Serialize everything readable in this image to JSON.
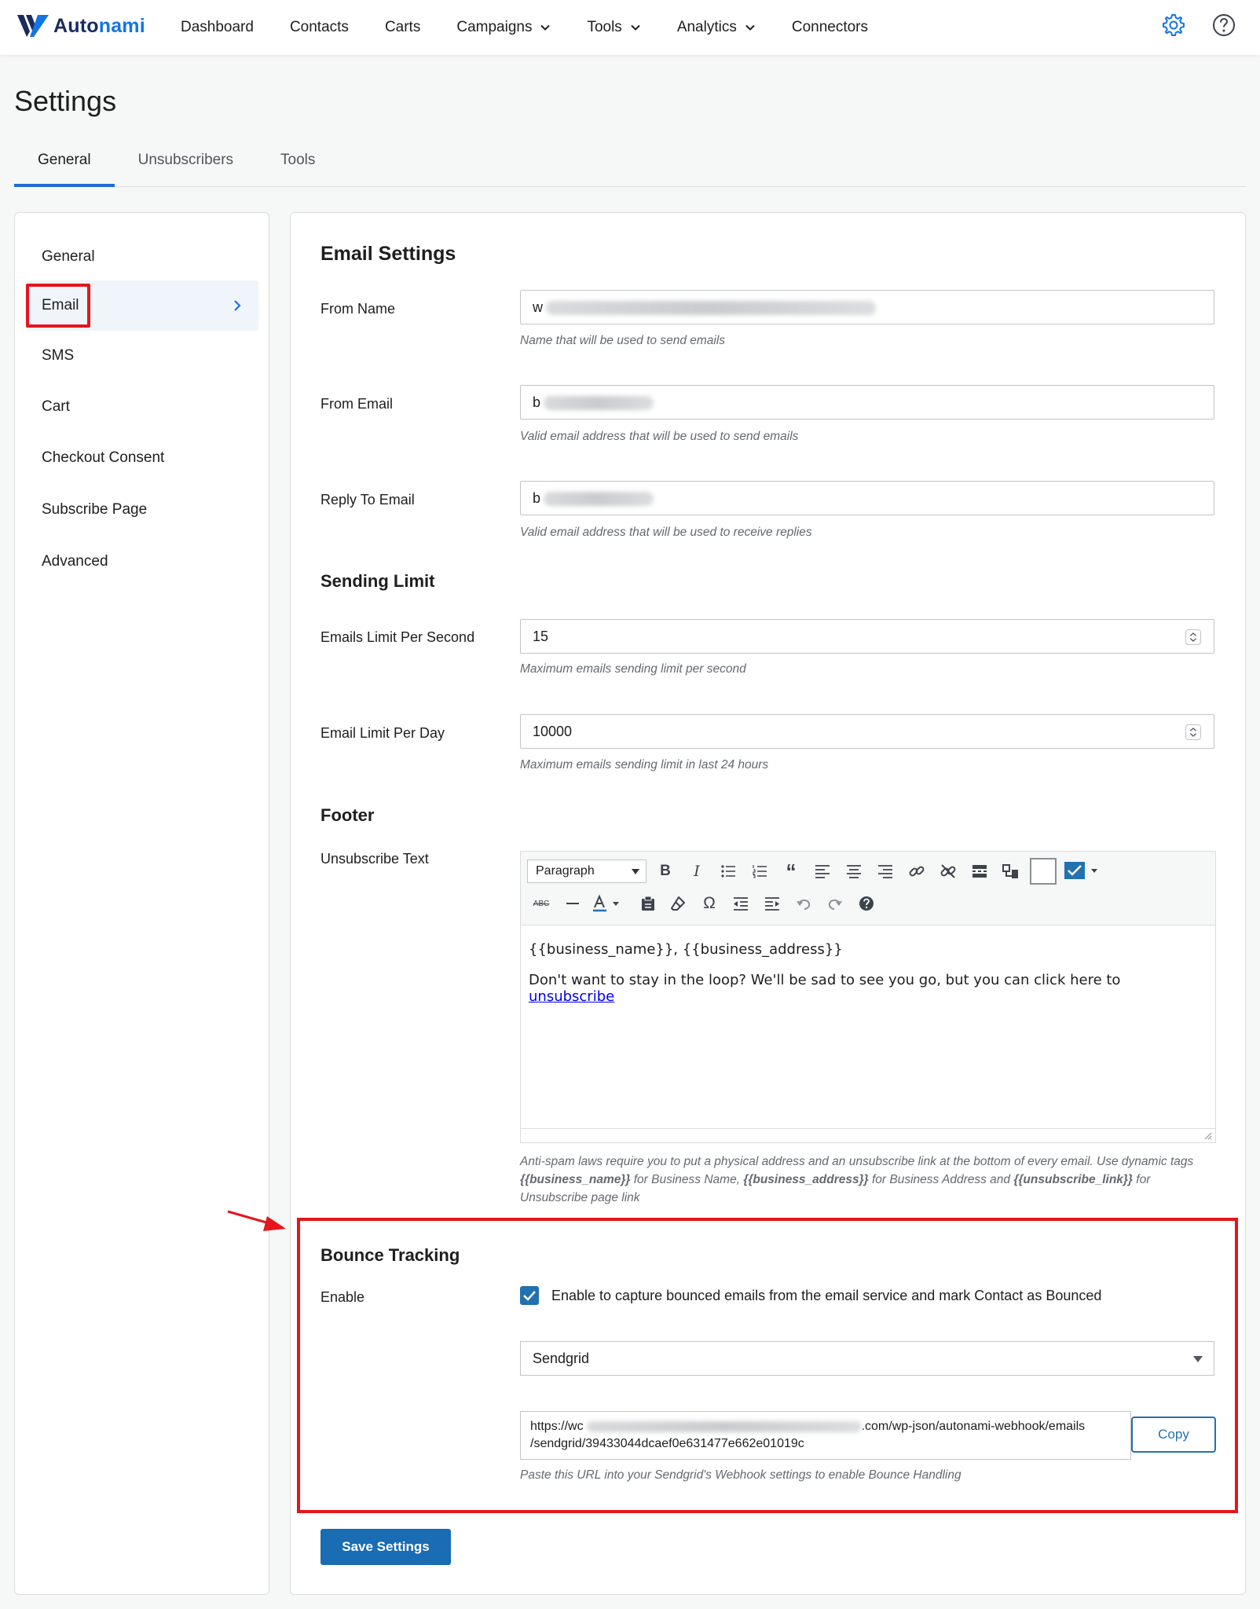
{
  "brand": {
    "name": "Autonami",
    "color": "#1474e4",
    "dark": "#1a2b5f"
  },
  "nav": [
    {
      "label": "Dashboard",
      "dropdown": false
    },
    {
      "label": "Contacts",
      "dropdown": false
    },
    {
      "label": "Carts",
      "dropdown": false
    },
    {
      "label": "Campaigns",
      "dropdown": true
    },
    {
      "label": "Tools",
      "dropdown": true
    },
    {
      "label": "Analytics",
      "dropdown": true
    },
    {
      "label": "Connectors",
      "dropdown": false
    }
  ],
  "page": {
    "title": "Settings"
  },
  "tabs": [
    "General",
    "Unsubscribers",
    "Tools"
  ],
  "sidebar": {
    "items": [
      "General",
      "Email",
      "SMS",
      "Cart",
      "Checkout Consent",
      "Subscribe Page",
      "Advanced"
    ],
    "active": "Email"
  },
  "email_settings": {
    "title": "Email Settings",
    "from_name": {
      "label": "From Name",
      "value": "w",
      "help": "Name that will be used to send emails"
    },
    "from_email": {
      "label": "From Email",
      "value": "b",
      "help": "Valid email address that will be used to send emails"
    },
    "reply_to": {
      "label": "Reply To Email",
      "value": "b",
      "help": "Valid email address that will be used to receive replies"
    }
  },
  "sending_limit": {
    "title": "Sending Limit",
    "per_second": {
      "label": "Emails Limit Per Second",
      "value": "15",
      "help": "Maximum emails sending limit per second"
    },
    "per_day": {
      "label": "Email Limit Per Day",
      "value": "10000",
      "help": "Maximum emails sending limit in last 24 hours"
    }
  },
  "footer": {
    "title": "Footer",
    "label": "Unsubscribe Text",
    "format": "Paragraph",
    "line1": "{{business_name}}, {{business_address}}",
    "line2": "Don't want to stay in the loop? We'll be sad to see you go, but you can click here to ",
    "link": "unsubscribe",
    "help": {
      "p1": "Anti-spam laws require you to put a physical address and an unsubscribe link at the bottom of every email. Use dynamic tags ",
      "t1": "{{business_name}}",
      "p2": " for Business Name, ",
      "t2": "{{business_address}}",
      "p3": " for Business Address and ",
      "t3": "{{unsubscribe_link}}",
      "p4": " for Unsubscribe page link"
    }
  },
  "bounce": {
    "title": "Bounce Tracking",
    "enable_label": "Enable",
    "checkbox_label": "Enable to capture bounced emails from the email service and mark Contact as Bounced",
    "checked": true,
    "provider": "Sendgrid",
    "url_start": "https://wc",
    "url_end": ".com/wp-json/autonami-webhook/emails",
    "url_line2": "/sendgrid/39433044dcaef0e631477e662e01019c",
    "copy_label": "Copy",
    "help": "Paste this URL into your Sendgrid's Webhook settings to enable Bounce Handling"
  },
  "save_label": "Save Settings",
  "colors": {
    "primary": "#2271b1",
    "highlight": "#e5151d",
    "tab_underline": "#1f6bd1"
  },
  "icons": [
    "settings-gear-icon",
    "help-icon",
    "chevron-down-icon",
    "chevron-right-icon",
    "checkmark-icon",
    "red-arrow-icon"
  ]
}
